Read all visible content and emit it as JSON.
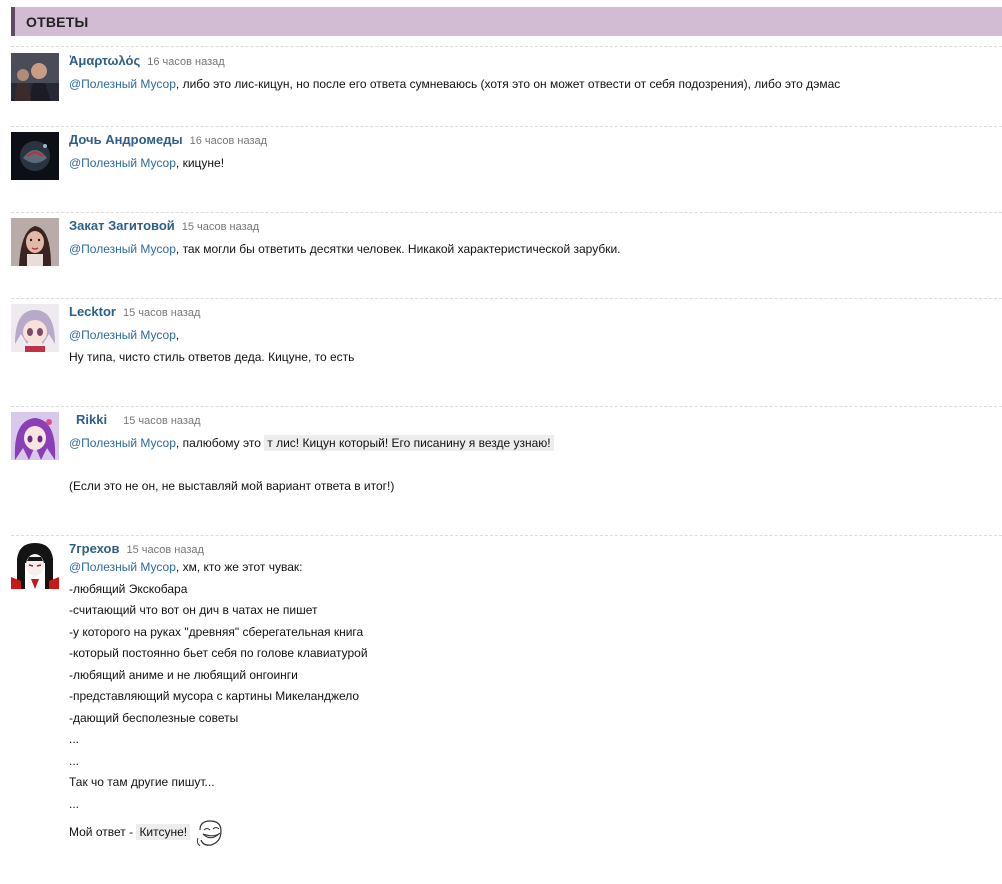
{
  "header": {
    "title": "ОТВЕТЫ"
  },
  "mention": "@Полезный Мусор",
  "comments": [
    {
      "author": "Ἀμαρτωλός",
      "time": "16 часов назад",
      "text": ", либо это лис-кицун, но после его ответа сумневаюсь (хотя это он может отвести от себя подозрения), либо это дэмас"
    },
    {
      "author": "Дочь Андромеды",
      "time": "16 часов назад",
      "text": ", кицуне!"
    },
    {
      "author": "Закат Загитовой",
      "time": "15 часов назад",
      "text": ", так могли бы ответить десятки человек. Никакой характеристической зарубки."
    },
    {
      "author": "Lecktor",
      "time": "15 часов назад",
      "text": ",",
      "line2": "Ну типа, чисто стиль ответов деда. Кицуне, то есть"
    },
    {
      "author": "Rikki",
      "time": "15 часов назад",
      "text": ", палюбому это ",
      "highlight": "т лис! Кицун который! Его писанину я везде узнаю!",
      "line2": "(Если это не он, не выставляй мой вариант ответа в итог!)"
    },
    {
      "author": "7грехов",
      "time": "15 часов назад",
      "text": ", хм, кто же этот чувак:",
      "lines": [
        "-любящий Экскобара",
        "-считающий что вот он дич в чатах не пишет",
        "-у которого на руках \"древняя\" сберегательная книга",
        "-который постоянно бьет себя по голове клавиатурой",
        "-любящий аниме и не любящий онгоинги",
        "-представляющий мусора с картины Микеланджело",
        "-дающий бесполезные советы",
        "...",
        "...",
        "Так чо там другие пишут...",
        "..."
      ],
      "answer_prefix": "Мой ответ - ",
      "answer": "Китсуне!"
    }
  ]
}
